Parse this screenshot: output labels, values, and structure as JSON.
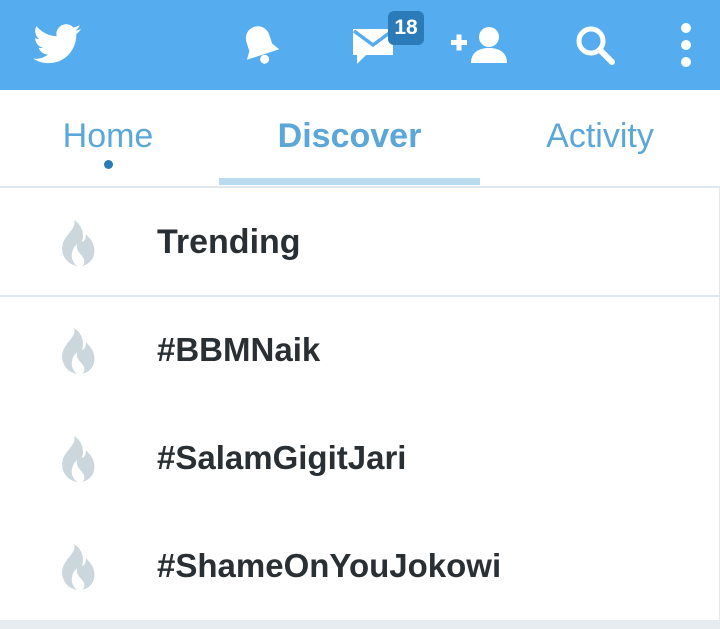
{
  "colors": {
    "brand": "#55acee",
    "badge": "#2b7bb9",
    "tab_text": "#5ba7d8",
    "text": "#292f33",
    "flame": "#ccd6dd"
  },
  "topbar": {
    "icons": [
      "twitter-bird-icon",
      "bell-icon",
      "envelope-icon",
      "add-user-icon",
      "search-icon",
      "overflow-menu-icon"
    ],
    "messages_badge": "18"
  },
  "tabs": [
    {
      "label": "Home",
      "has_unread_dot": true
    },
    {
      "label": "Discover",
      "active": true
    },
    {
      "label": "Activity"
    }
  ],
  "discover": {
    "section_title": "Trending",
    "trends": [
      "#BBMNaik",
      "#SalamGigitJari",
      "#ShameOnYouJokowi"
    ]
  }
}
